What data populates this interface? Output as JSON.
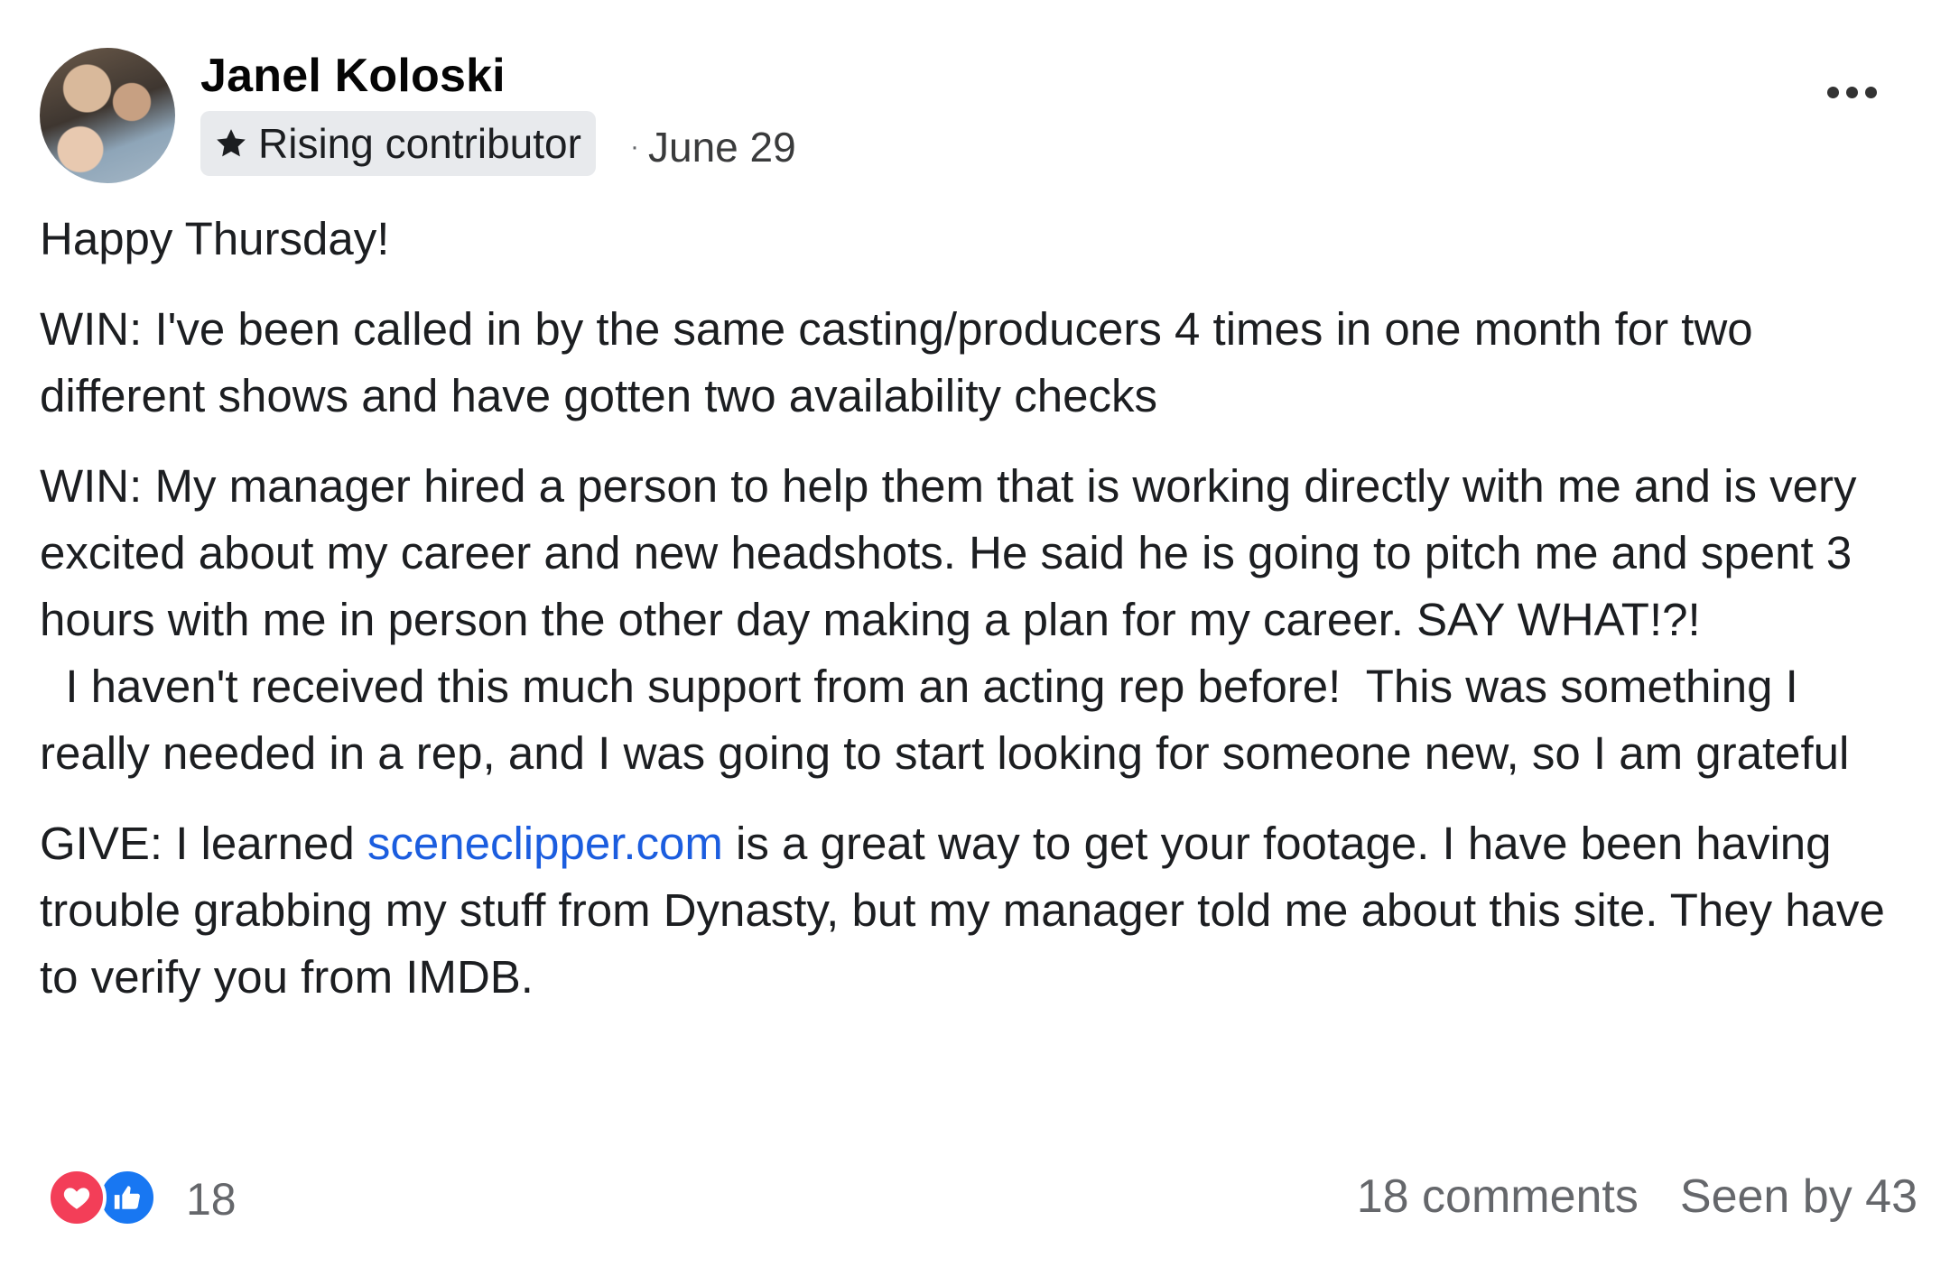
{
  "post": {
    "author": "Janel Koloski",
    "badge": "Rising contributor",
    "date": "June 29",
    "separator": "·",
    "greeting": "Happy Thursday!",
    "win1": "WIN:  I've been called in by the same casting/producers 4 times in one month for two different shows and have gotten two availability checks",
    "win2": "WIN: My manager hired a person to help them that is working directly with me and is very excited about my career and new headshots.  He said he is going to pitch me and spent 3 hours with me in person the other day making a plan for my career. SAY WHAT!?!",
    "win2_cont": "  I haven't received this much support from an acting rep before!  This was something I really needed in a rep, and I was going to start looking for someone new, so I am grateful",
    "give_prefix": "GIVE: I learned ",
    "give_link": "sceneclipper.com",
    "give_suffix": " is a great way to get your footage.  I have been having trouble grabbing my stuff from Dynasty, but my manager told me about this site.  They have to verify you from IMDB."
  },
  "footer": {
    "reaction_count": "18",
    "comments": "18 comments",
    "seen_by": "Seen by 43"
  },
  "icons": {
    "badge": "star-icon",
    "more": "more-options-icon",
    "reactions": [
      "love-reaction-icon",
      "like-reaction-icon"
    ]
  },
  "colors": {
    "link": "#1b5ddf",
    "love": "#f33e58",
    "like": "#1877f2",
    "badge_bg": "#e8eaed",
    "muted": "#65676b"
  }
}
